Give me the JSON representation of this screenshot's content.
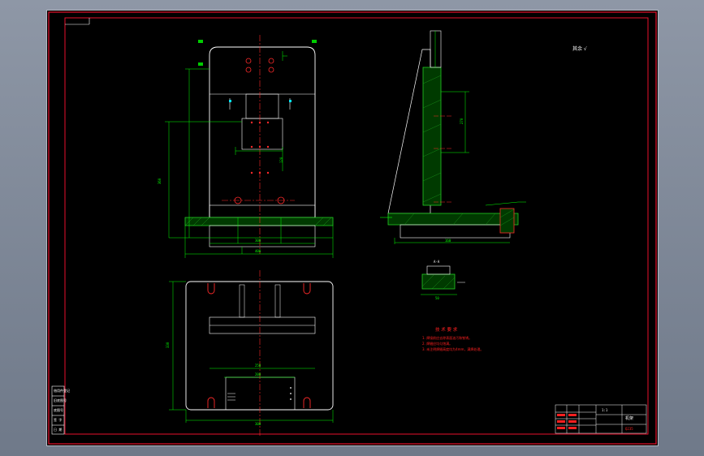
{
  "sheet": {
    "roughness_symbol": "其余 √",
    "detail_view_label": "A-A",
    "dims": {
      "front_width": "400",
      "front_base": "300",
      "front_height": "360",
      "front_mid": "120",
      "side_height": "270",
      "side_base": "160",
      "plan_height": "330",
      "plan_width": "300",
      "plan_inner": "250",
      "plan_inner2": "200",
      "detail_width": "50"
    }
  },
  "tech_requirements": {
    "title": "技 术 要 求",
    "lines": [
      "1. 焊接前应去除表面油污和铁锈。",
      "2. 焊缝应均匀饱满。",
      "3. 未注明焊缝高度均为4mm，满焊处理。"
    ]
  },
  "title_block": {
    "drawing_title": "机架",
    "scale": "1:1",
    "material": "Q235"
  },
  "colors": {
    "frame_red": "#e8112d",
    "outline_white": "#ffffff",
    "dimension_green": "#00ff00",
    "hatch_green": "#33dd33",
    "centerline_red": "#ff2a2a",
    "label_yellow": "#ffff00",
    "text_red": "#ff2020"
  }
}
